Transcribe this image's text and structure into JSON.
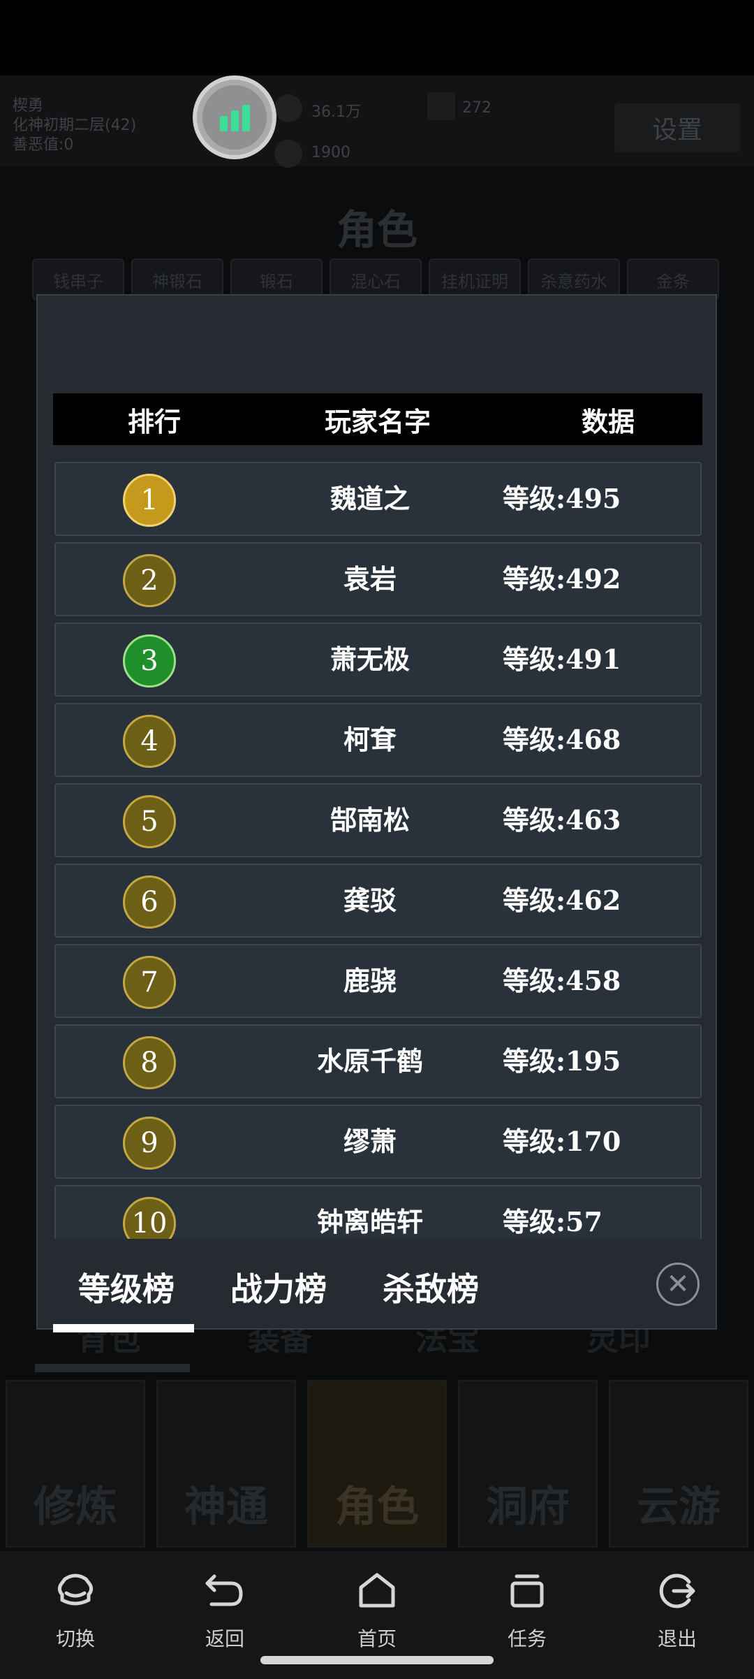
{
  "background": {
    "player_name": "楔勇",
    "realm": "化神初期二层(42)",
    "karma": "善恶值:0",
    "stat_a": "36.1万",
    "stat_b": "272",
    "stat_c": "1900",
    "settings_label": "设置",
    "title": "角色",
    "item_tabs": [
      "钱串子",
      "神锻石",
      "锻石",
      "混心石",
      "挂机证明",
      "杀意药水",
      "金条"
    ],
    "bottom_tabs": [
      "背包",
      "装备",
      "法宝",
      "灵印"
    ],
    "cards": [
      "修炼",
      "神通",
      "角色",
      "洞府",
      "云游"
    ]
  },
  "leaderboard": {
    "headers": {
      "rank": "排行",
      "name": "玩家名字",
      "data": "数据"
    },
    "rows": [
      {
        "rank": "1",
        "name": "魏道之",
        "data": "等级:495",
        "medal": "gold"
      },
      {
        "rank": "2",
        "name": "袁岩",
        "data": "等级:492",
        "medal": "olive"
      },
      {
        "rank": "3",
        "name": "萧无极",
        "data": "等级:491",
        "medal": "green"
      },
      {
        "rank": "4",
        "name": "柯耷",
        "data": "等级:468",
        "medal": "olive"
      },
      {
        "rank": "5",
        "name": "郜南松",
        "data": "等级:463",
        "medal": "olive"
      },
      {
        "rank": "6",
        "name": "龚驳",
        "data": "等级:462",
        "medal": "olive"
      },
      {
        "rank": "7",
        "name": "鹿骁",
        "data": "等级:458",
        "medal": "olive"
      },
      {
        "rank": "8",
        "name": "水原千鹤",
        "data": "等级:195",
        "medal": "olive"
      },
      {
        "rank": "9",
        "name": "缪萧",
        "data": "等级:170",
        "medal": "olive"
      },
      {
        "rank": "10",
        "name": "钟离皓轩",
        "data": "等级:57",
        "medal": "olive"
      }
    ],
    "tabs": [
      "等级榜",
      "战力榜",
      "杀敌榜"
    ],
    "active_tab": "等级榜",
    "close_icon": "close-icon"
  },
  "navbar": {
    "items": [
      {
        "label": "切换",
        "icon": "switch-icon"
      },
      {
        "label": "返回",
        "icon": "back-icon"
      },
      {
        "label": "首页",
        "icon": "home-icon"
      },
      {
        "label": "任务",
        "icon": "tasks-icon"
      },
      {
        "label": "退出",
        "icon": "exit-icon"
      }
    ]
  },
  "colors": {
    "modal_bg": "#262b31",
    "row_bg": "#29313a",
    "medal_gold": "#c59a1c",
    "medal_olive": "#6e5f17",
    "medal_green": "#1e8f2a",
    "fab_bars": "#3ddc97"
  }
}
